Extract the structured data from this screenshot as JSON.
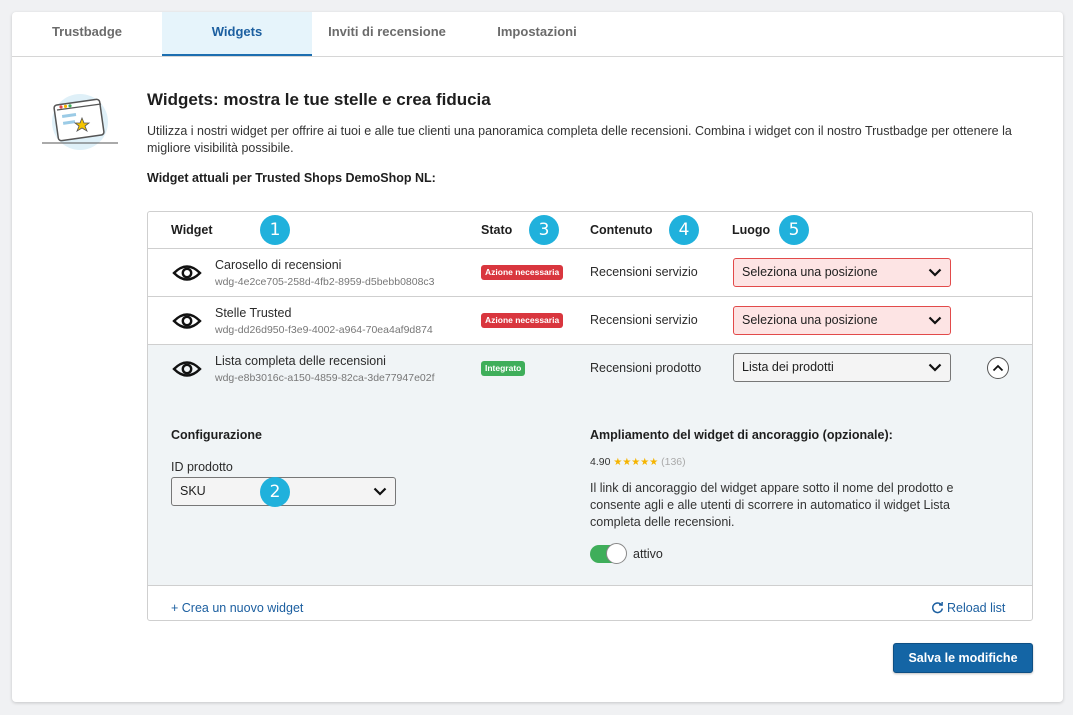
{
  "tabs": [
    "Trustbadge",
    "Widgets",
    "Inviti di recensione",
    "Impostazioni"
  ],
  "page": {
    "title": "Widgets: mostra le tue stelle e crea fiducia",
    "description": "Utilizza i nostri widget per offrire ai tuoi e alle tue clienti una panoramica completa delle recensioni. Combina i widget con il nostro Trustbadge per ottenere la migliore visibilità possibile.",
    "subtitle": "Widget attuali per Trusted Shops DemoShop NL:"
  },
  "table": {
    "headers": {
      "widget": "Widget",
      "stato": "Stato",
      "contenuto": "Contenuto",
      "luogo": "Luogo"
    },
    "step_numbers": [
      "1",
      "2",
      "3",
      "4",
      "5"
    ],
    "rows": [
      {
        "name": "Carosello di recensioni",
        "id": "wdg-4e2ce705-258d-4fb2-8959-d5bebb0808c3",
        "status": "Azione necessaria",
        "content": "Recensioni servizio",
        "location": "Seleziona una posizione"
      },
      {
        "name": "Stelle Trusted",
        "id": "wdg-dd26d950-f3e9-4002-a964-70ea4af9d874",
        "status": "Azione necessaria",
        "content": "Recensioni servizio",
        "location": "Seleziona una posizione"
      },
      {
        "name": "Lista completa delle recensioni",
        "id": "wdg-e8b3016c-a150-4859-82ca-3de77947e02f",
        "status": "Integrato",
        "content": "Recensioni prodotto",
        "location": "Lista dei prodotti"
      }
    ]
  },
  "config": {
    "title": "Configurazione",
    "product_id_label": "ID prodotto",
    "product_id_value": "SKU",
    "anchor_title": "Ampliamento del widget di ancoraggio (opzionale):",
    "rating": "4.90",
    "stars": "★★★★★",
    "review_count": "(136)",
    "anchor_desc": "Il link di ancoraggio del widget appare sotto il nome del prodotto e consente agli e alle utenti di scorrere in automatico il widget Lista completa delle recensioni.",
    "toggle_label": "attivo",
    "toggle_on": true
  },
  "footer": {
    "create_link": "+ Crea un nuovo widget",
    "reload_link": "Reload list"
  },
  "save_button": "Salva le modifiche",
  "colors": {
    "accent": "#1465a5",
    "step_badge": "#20b1dc",
    "status_red": "#d9363e",
    "status_green": "#3fae5a",
    "select_error_bg": "#fde4e4",
    "active_tab_bg": "#e6f4fb"
  }
}
